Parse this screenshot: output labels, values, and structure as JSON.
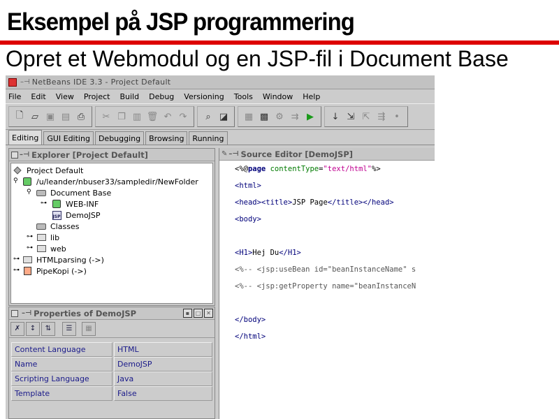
{
  "slide": {
    "title": "Eksempel på JSP programmering",
    "subtitle": "Opret et Webmodul og en JSP-fil i Document Base"
  },
  "ide": {
    "title": "NetBeans IDE 3.3 - Project Default",
    "menu": [
      "File",
      "Edit",
      "View",
      "Project",
      "Build",
      "Debug",
      "Versioning",
      "Tools",
      "Window",
      "Help"
    ],
    "workspace_tabs": [
      "Editing",
      "GUI Editing",
      "Debugging",
      "Browsing",
      "Running"
    ],
    "active_tab": "Editing",
    "explorer": {
      "title": "Explorer [Project Default]",
      "nodes": [
        {
          "label": "Project Default",
          "icon": "project-icon"
        },
        {
          "label": "/u/leander/nbuser33/sampledir/NewFolder",
          "icon": "mounted-filesystem-icon"
        },
        {
          "label": "Document Base",
          "icon": "document-base-icon"
        },
        {
          "label": "WEB-INF",
          "icon": "web-inf-icon"
        },
        {
          "label": "DemoJSP",
          "icon": "jsp-file-icon"
        },
        {
          "label": "Classes",
          "icon": "classes-folder-icon"
        },
        {
          "label": "lib",
          "icon": "folder-icon"
        },
        {
          "label": "web",
          "icon": "folder-icon"
        },
        {
          "label": "HTMLparsing (->)",
          "icon": "folder-icon"
        },
        {
          "label": "PipeKopi (->)",
          "icon": "pipe-icon"
        }
      ]
    },
    "properties": {
      "title": "Properties of DemoJSP",
      "rows": [
        {
          "name": "Content Language",
          "value": "HTML"
        },
        {
          "name": "Name",
          "value": "DemoJSP"
        },
        {
          "name": "Scripting Language",
          "value": "Java"
        },
        {
          "name": "Template",
          "value": "False"
        }
      ]
    },
    "editor": {
      "title": "Source Editor [DemoJSP]",
      "lines": {
        "l1_a": "<%@",
        "l1_b": "page",
        "l1_c": "contentType",
        "l1_d": "=",
        "l1_e": "\"text/html\"",
        "l1_f": "%>",
        "l2": "<html>",
        "l3_a": "<head><title>",
        "l3_b": "JSP Page",
        "l3_c": "</title></head>",
        "l4": "<body>",
        "l5_a": "<H1>",
        "l5_b": "Hej Du",
        "l5_c": "</H1>",
        "l6": "<%-- <jsp:useBean id=\"beanInstanceName\" s",
        "l7": "<%-- <jsp:getProperty name=\"beanInstanceN",
        "l8": "</body>",
        "l9": "</html>"
      }
    }
  }
}
